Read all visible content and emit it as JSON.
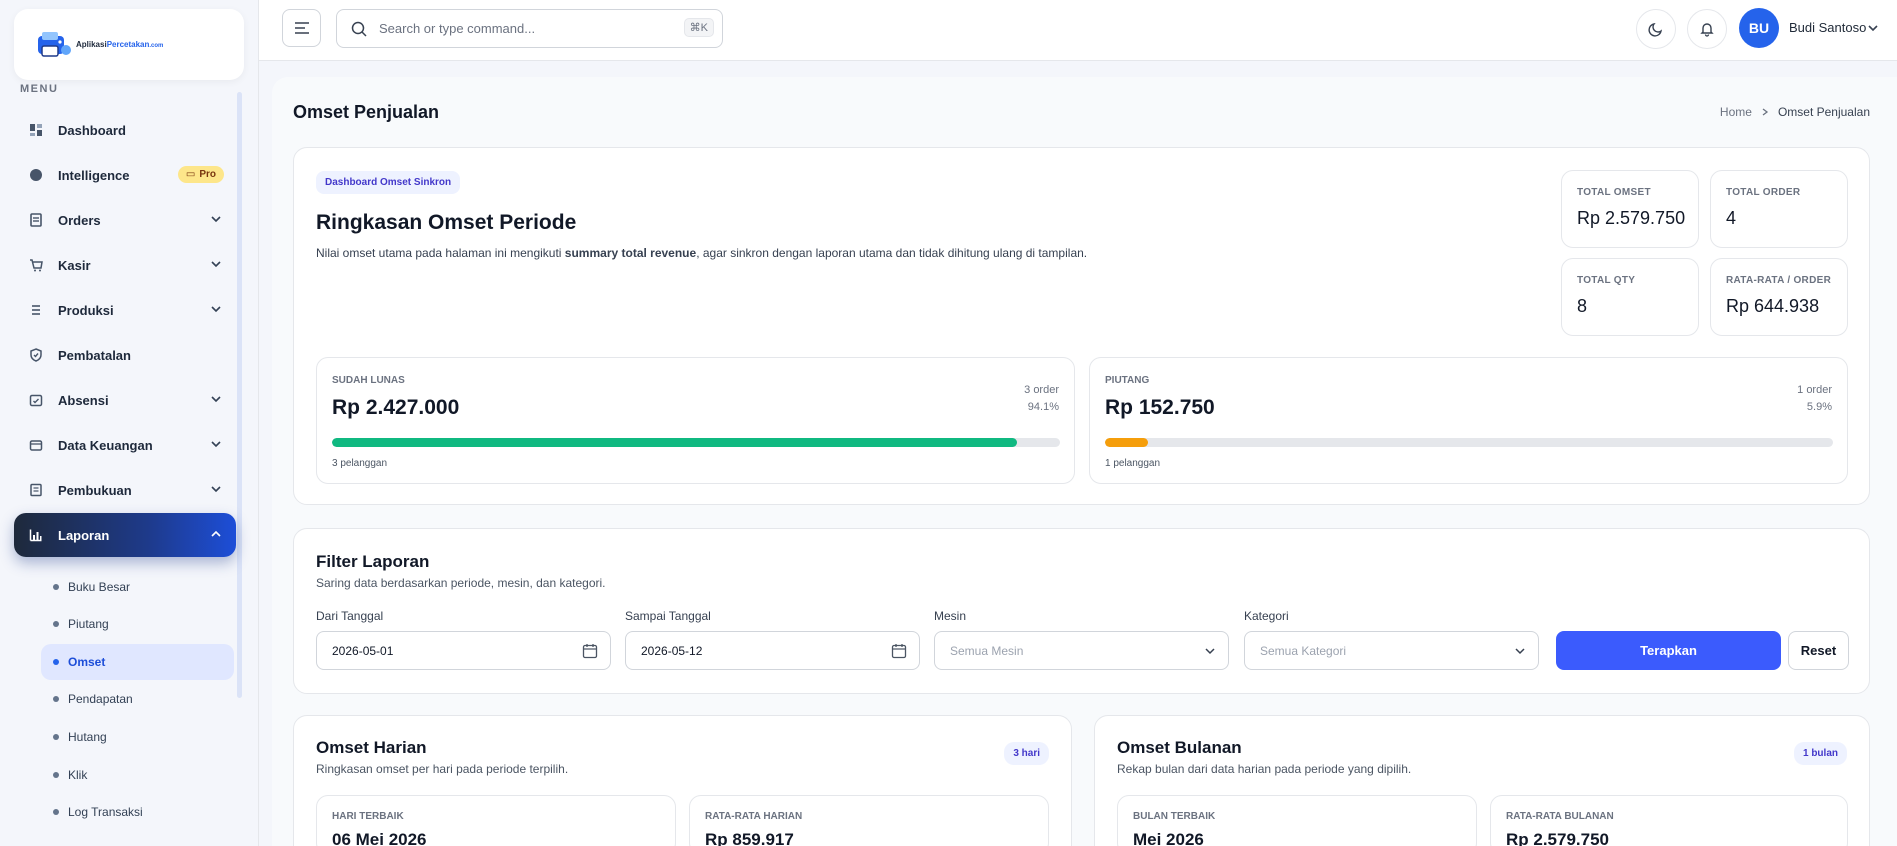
{
  "app": {
    "logo_main": "Aplikasi",
    "logo_accent": "Percetakan",
    "logo_suffix": ".com"
  },
  "sidebar": {
    "menu_label": "MENU",
    "items": [
      {
        "label": "Dashboard"
      },
      {
        "label": "Intelligence",
        "badge": "Pro"
      },
      {
        "label": "Orders"
      },
      {
        "label": "Kasir"
      },
      {
        "label": "Produksi"
      },
      {
        "label": "Pembatalan"
      },
      {
        "label": "Absensi"
      },
      {
        "label": "Data Keuangan"
      },
      {
        "label": "Pembukuan"
      },
      {
        "label": "Laporan"
      }
    ],
    "sub_items": [
      {
        "label": "Buku Besar"
      },
      {
        "label": "Piutang"
      },
      {
        "label": "Omset"
      },
      {
        "label": "Pendapatan"
      },
      {
        "label": "Hutang"
      },
      {
        "label": "Klik"
      },
      {
        "label": "Log Transaksi"
      }
    ]
  },
  "topbar": {
    "search_placeholder": "Search or type command...",
    "shortcut": "⌘K",
    "avatar_initials": "BU",
    "user_name": "Budi Santoso"
  },
  "page": {
    "title": "Omset Penjualan",
    "breadcrumb": {
      "home": "Home",
      "current": "Omset Penjualan"
    }
  },
  "summary": {
    "chip": "Dashboard Omset Sinkron",
    "heading": "Ringkasan Omset Periode",
    "desc_before": "Nilai omset utama pada halaman ini mengikuti ",
    "desc_bold": "summary total revenue",
    "desc_after": ", agar sinkron dengan laporan utama dan tidak dihitung ulang di tampilan.",
    "stats": [
      {
        "label": "TOTAL OMSET",
        "value": "Rp 2.579.750"
      },
      {
        "label": "TOTAL ORDER",
        "value": "4"
      },
      {
        "label": "TOTAL QTY",
        "value": "8"
      },
      {
        "label": "RATA-RATA / ORDER",
        "value": "Rp 644.938"
      }
    ],
    "paid": {
      "label": "SUDAH LUNAS",
      "value": "Rp 2.427.000",
      "orders": "3 order",
      "percent": "94.1%",
      "fraction": 0.941,
      "customers": "3 pelanggan",
      "color": "#10b981"
    },
    "receivable": {
      "label": "PIUTANG",
      "value": "Rp 152.750",
      "orders": "1 order",
      "percent": "5.9%",
      "fraction": 0.059,
      "customers": "1 pelanggan",
      "color": "#f59e0b"
    }
  },
  "filter": {
    "title": "Filter Laporan",
    "desc": "Saring data berdasarkan periode, mesin, dan kategori.",
    "from_label": "Dari Tanggal",
    "from_value": "2026-05-01",
    "to_label": "Sampai Tanggal",
    "to_value": "2026-05-12",
    "machine_label": "Mesin",
    "machine_value": "Semua Mesin",
    "category_label": "Kategori",
    "category_value": "Semua Kategori",
    "apply": "Terapkan",
    "reset": "Reset"
  },
  "daily": {
    "title": "Omset Harian",
    "desc": "Ringkasan omset per hari pada periode terpilih.",
    "pill": "3 hari",
    "best_label": "HARI TERBAIK",
    "best_value": "06 Mei 2026",
    "avg_label": "RATA-RATA HARIAN",
    "avg_value": "Rp 859.917"
  },
  "monthly": {
    "title": "Omset Bulanan",
    "desc": "Rekap bulan dari data harian pada periode yang dipilih.",
    "pill": "1 bulan",
    "best_label": "BULAN TERBAIK",
    "best_value": "Mei 2026",
    "avg_label": "RATA-RATA BULANAN",
    "avg_value": "Rp 2.579.750"
  },
  "colors": {
    "primary": "#3b5bfd",
    "success": "#10b981",
    "warning": "#f59e0b",
    "sidebar_active": "#1e3a8a"
  }
}
